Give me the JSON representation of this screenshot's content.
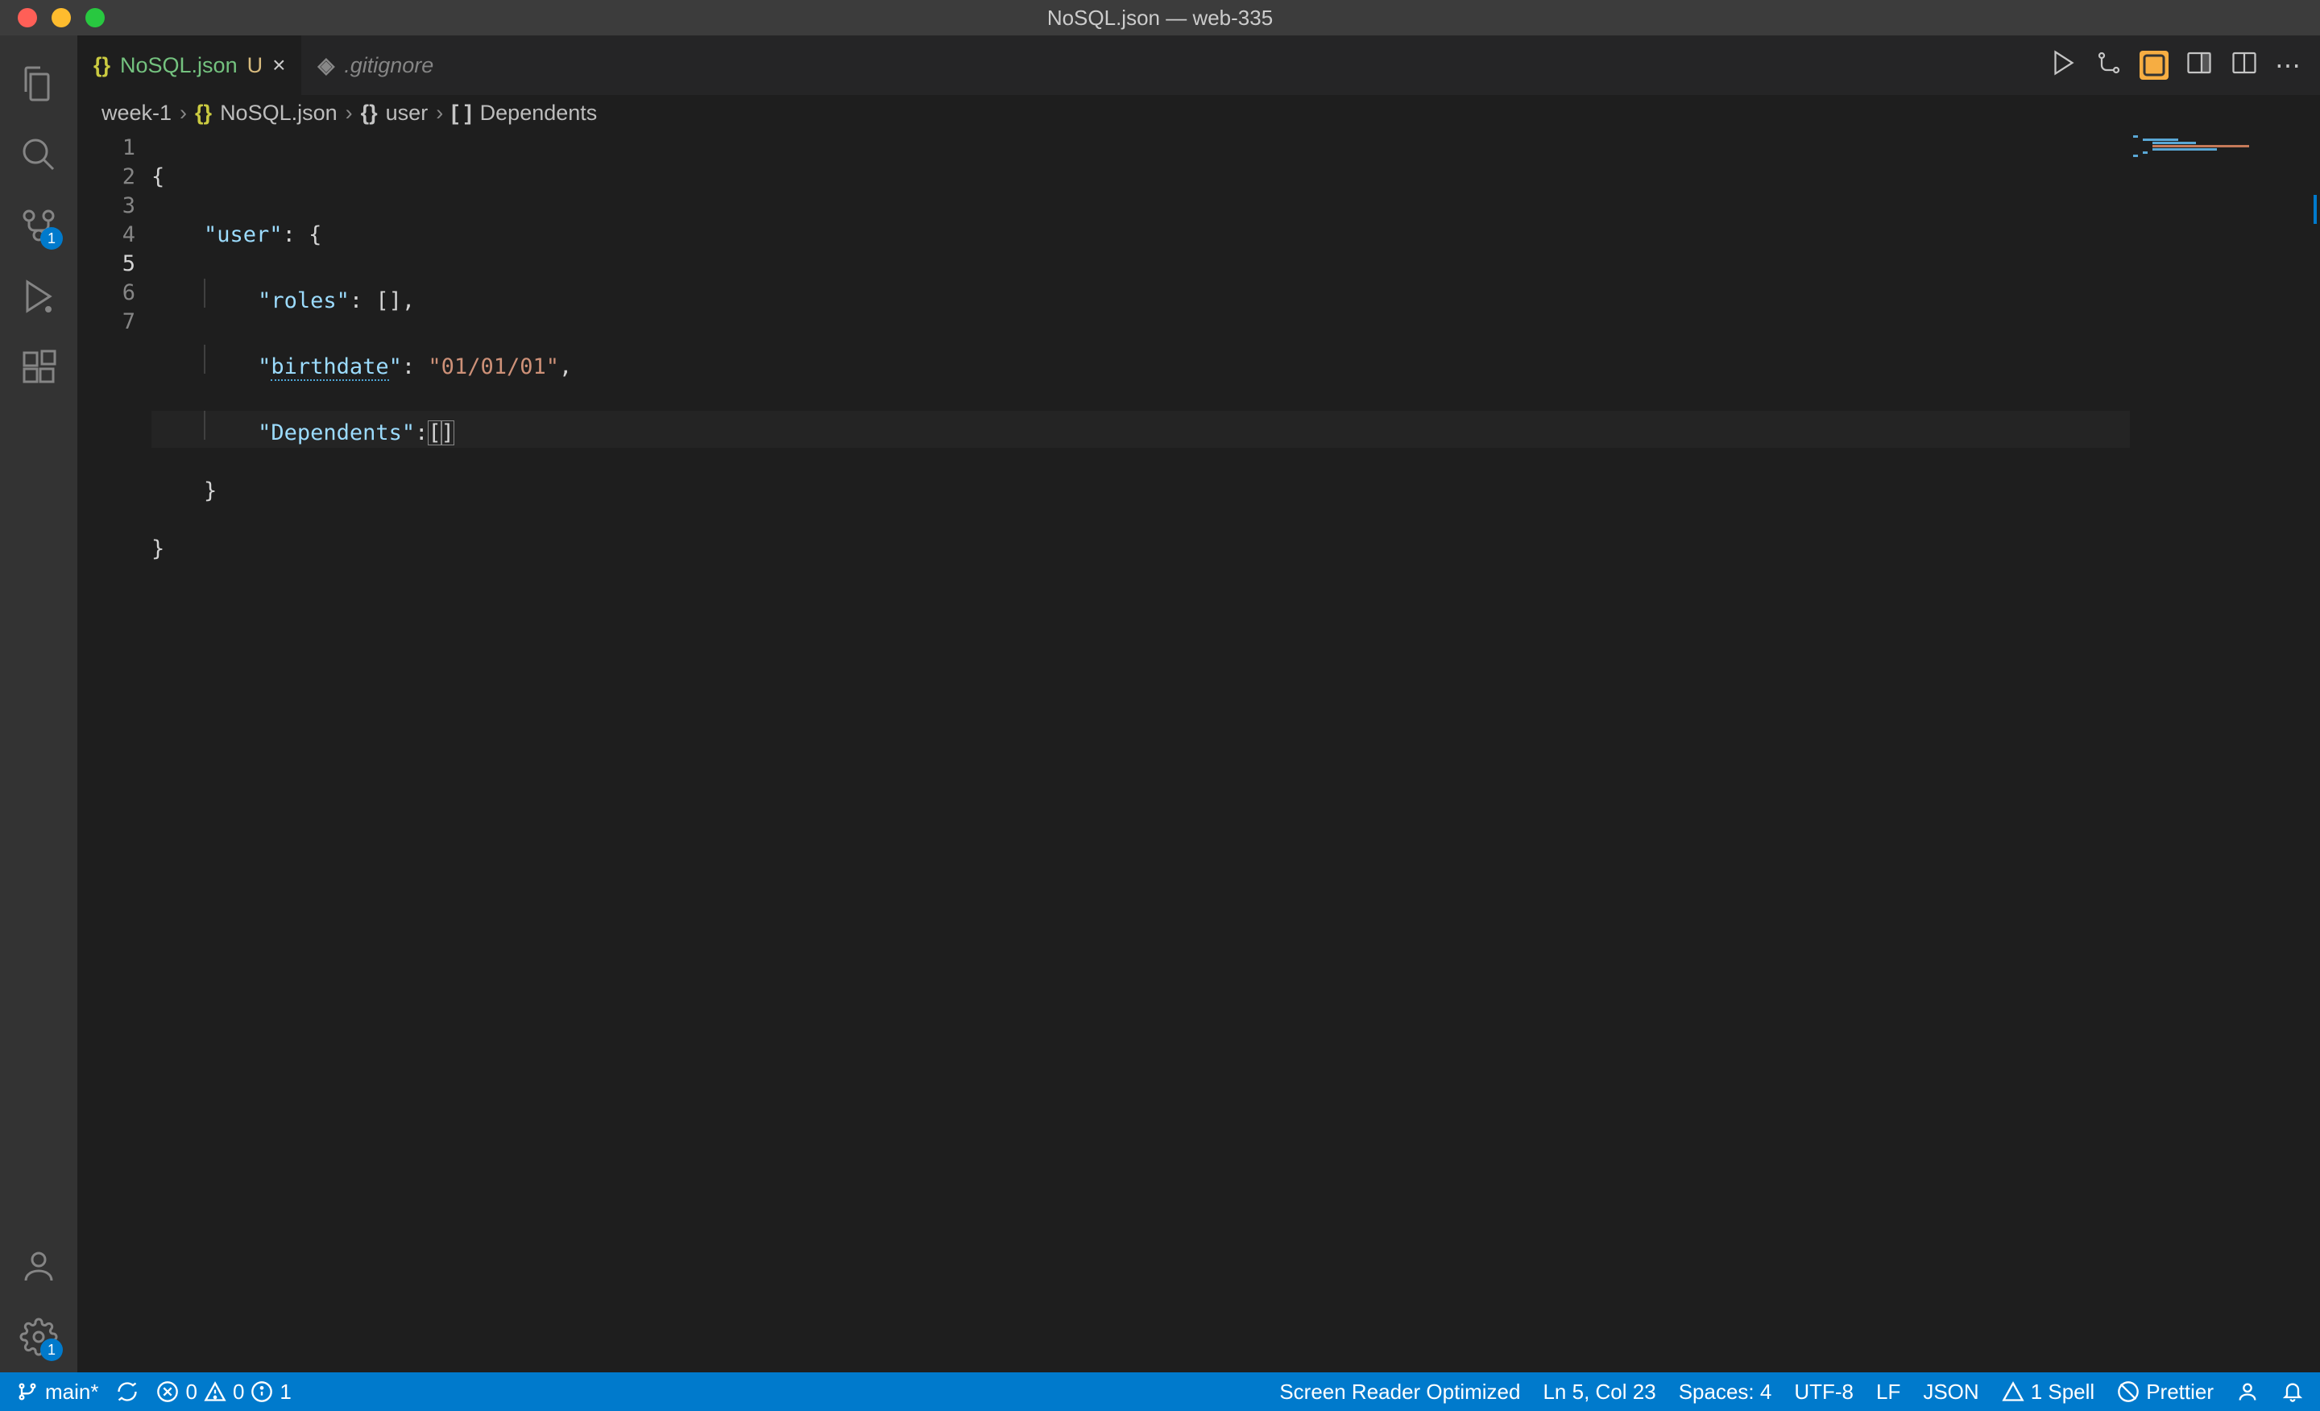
{
  "title": "NoSQL.json — web-335",
  "tabs": [
    {
      "icon": "{}",
      "name": "NoSQL.json",
      "modified": "U",
      "active": true
    },
    {
      "icon": "◈",
      "name": ".gitignore",
      "active": false
    }
  ],
  "breadcrumb": [
    "week-1",
    "NoSQL.json",
    "user",
    "Dependents"
  ],
  "breadcrumb_icons": [
    "",
    "{}",
    "{}",
    "[ ]"
  ],
  "code": {
    "lines": [
      {
        "num": "1",
        "raw": "{"
      },
      {
        "num": "2",
        "k1": "user",
        "raw_tail": ": {"
      },
      {
        "num": "3",
        "k1": "roles",
        "raw_tail": ": [],"
      },
      {
        "num": "4",
        "k1": "birthdate",
        "val": "01/01/01",
        "raw_tail": ","
      },
      {
        "num": "5",
        "k1": "Dependents",
        "raw_tail": ":[]"
      },
      {
        "num": "6",
        "raw": "}"
      },
      {
        "num": "7",
        "raw": "}"
      }
    ],
    "cursor_line": 5
  },
  "scm_badge": "1",
  "gear_badge": "1",
  "status": {
    "branch": "main*",
    "errors": "0",
    "warnings": "0",
    "info": "1",
    "screen_reader": "Screen Reader Optimized",
    "position": "Ln 5, Col 23",
    "spaces": "Spaces: 4",
    "encoding": "UTF-8",
    "eol": "LF",
    "lang": "JSON",
    "spell": "1 Spell",
    "prettier": "Prettier"
  },
  "icons": {
    "run": "▷",
    "more": "⋯"
  }
}
